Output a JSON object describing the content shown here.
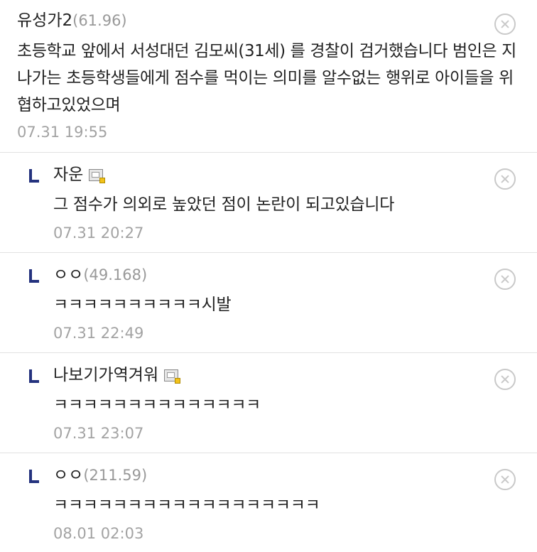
{
  "main_comment": {
    "nickname": "유성가2",
    "ip": "(61.96)",
    "body": "초등학교 앞에서 서성대던 김모씨(31세) 를 경찰이 검거했습니다 범인은 지나가는 초등학생들에게 점수를 먹이는 의미를 알수없는 행위로 아이들을 위협하고있었으며",
    "date": "07.31 19:55",
    "delete_icon": "close-circle-icon"
  },
  "replies": [
    {
      "nickname": "자운",
      "ip": "",
      "member_icon": "gallery-member-icon",
      "body": "그 점수가 의외로 높았던 점이 논란이 되고있습니다",
      "date": "07.31 20:27"
    },
    {
      "nickname": "ㅇㅇ",
      "ip": "(49.168)",
      "member_icon": "",
      "body": "ㅋㅋㅋㅋㅋㅋㅋㅋㅋㅋ시발",
      "date": "07.31 22:49"
    },
    {
      "nickname": "나보기가역겨워",
      "ip": "",
      "member_icon": "gallery-member-icon",
      "body": "ㅋㅋㅋㅋㅋㅋㅋㅋㅋㅋㅋㅋㅋㅋ",
      "date": "07.31 23:07"
    },
    {
      "nickname": "ㅇㅇ",
      "ip": "(211.59)",
      "member_icon": "",
      "body": "ㅋㅋㅋㅋㅋㅋㅋㅋㅋㅋㅋㅋㅋㅋㅋㅋㅋㅋ",
      "date": "08.01 02:03"
    }
  ],
  "colors": {
    "reply_marker": "#24327e",
    "meta_gray": "#a3a3a3",
    "divider": "#e2e2e2"
  }
}
